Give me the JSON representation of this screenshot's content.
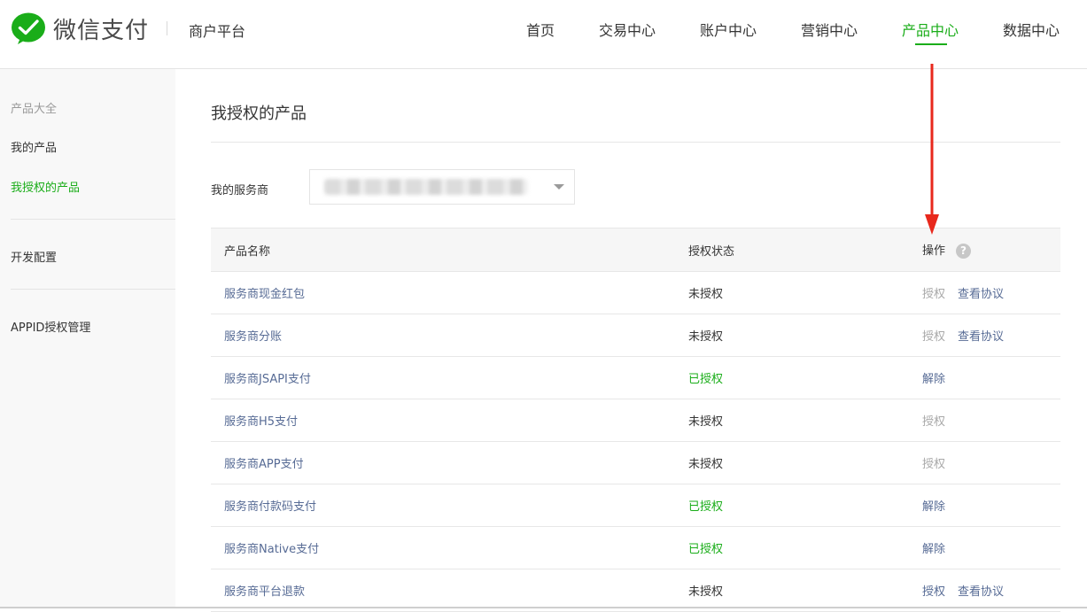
{
  "header": {
    "brand": "微信支付",
    "platform": "商户平台",
    "nav": [
      "首页",
      "交易中心",
      "账户中心",
      "营销中心",
      "产品中心",
      "数据中心"
    ],
    "active_nav": "产品中心"
  },
  "sidebar": {
    "group_title": "产品大全",
    "items": [
      "我的产品",
      "我授权的产品"
    ],
    "active_item": "我授权的产品",
    "dev_config": "开发配置",
    "appid": "APPID授权管理"
  },
  "main": {
    "title": "我授权的产品",
    "provider_label": "我的服务商",
    "columns": [
      "产品名称",
      "授权状态",
      "操作"
    ]
  },
  "rows": [
    {
      "name": "服务商现金红包",
      "status": "未授权",
      "ops": [
        "授权",
        "查看协议"
      ]
    },
    {
      "name": "服务商分账",
      "status": "未授权",
      "ops": [
        "授权",
        "查看协议"
      ]
    },
    {
      "name": "服务商JSAPI支付",
      "status": "已授权",
      "ops": [
        "解除"
      ]
    },
    {
      "name": "服务商H5支付",
      "status": "未授权",
      "ops": [
        "授权"
      ]
    },
    {
      "name": "服务商APP支付",
      "status": "未授权",
      "ops": [
        "授权"
      ]
    },
    {
      "name": "服务商付款码支付",
      "status": "已授权",
      "ops": [
        "解除"
      ]
    },
    {
      "name": "服务商Native支付",
      "status": "已授权",
      "ops": [
        "解除"
      ]
    },
    {
      "name": "服务商平台退款",
      "status": "未授权",
      "ops": [
        "授权",
        "查看协议"
      ]
    }
  ],
  "colors": {
    "accent": "#1aad19",
    "link": "#576b95",
    "annotation_arrow": "#e8281c"
  },
  "icons": {
    "logo": "wechat-pay-logo-icon",
    "help": "help-circle-icon",
    "dropdown": "chevron-down-icon",
    "annotation": "red-arrow-annotation"
  }
}
